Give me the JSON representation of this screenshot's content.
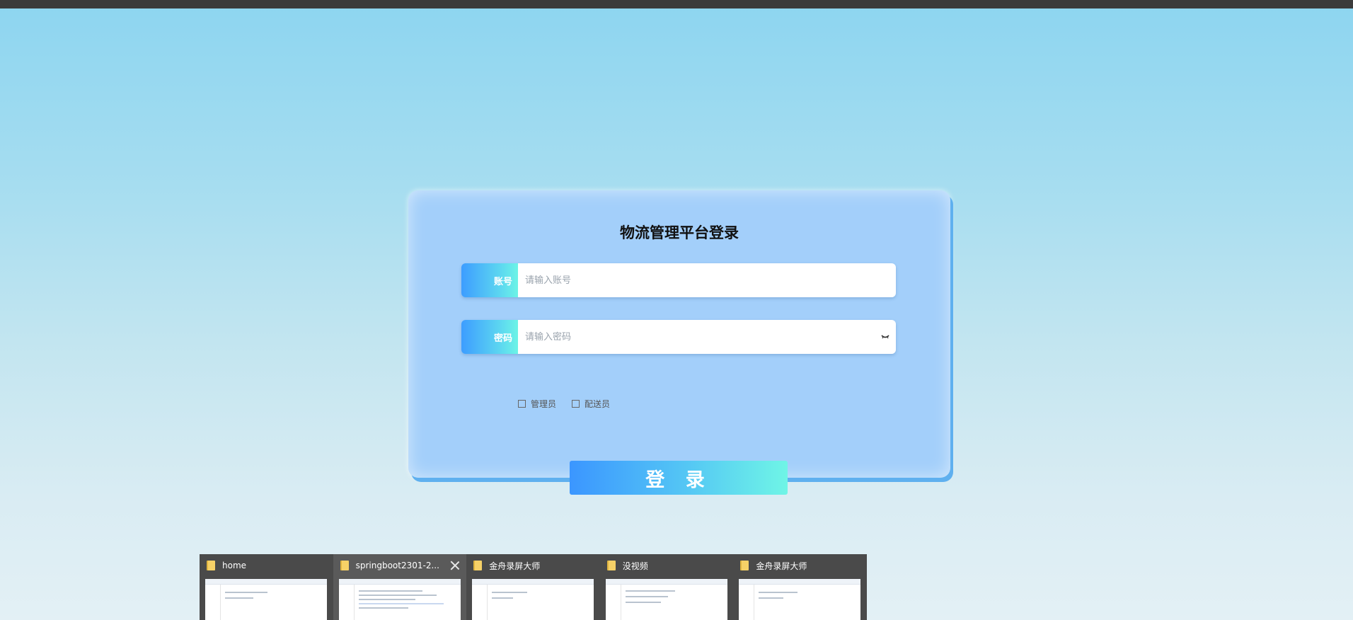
{
  "login": {
    "title": "物流管理平台登录",
    "account_label": "账号",
    "account_placeholder": "请输入账号",
    "password_label": "密码",
    "password_placeholder": "请输入密码",
    "roles": [
      "管理员",
      "配送员"
    ],
    "submit_label": "登 录"
  },
  "taskbar": {
    "windows": [
      {
        "title": "home",
        "icon": "folder-icon"
      },
      {
        "title": "springboot2301-2...",
        "icon": "folder-icon",
        "active": true
      },
      {
        "title": "金舟录屏大师",
        "icon": "folder-icon"
      },
      {
        "title": "没视频",
        "icon": "folder-icon"
      },
      {
        "title": "金舟录屏大师",
        "icon": "folder-icon"
      }
    ]
  },
  "colors": {
    "card": "#a3cffa",
    "accent_start": "#3b96ff",
    "accent_end": "#6ff5e6",
    "top_bar": "#3b3b3b"
  }
}
